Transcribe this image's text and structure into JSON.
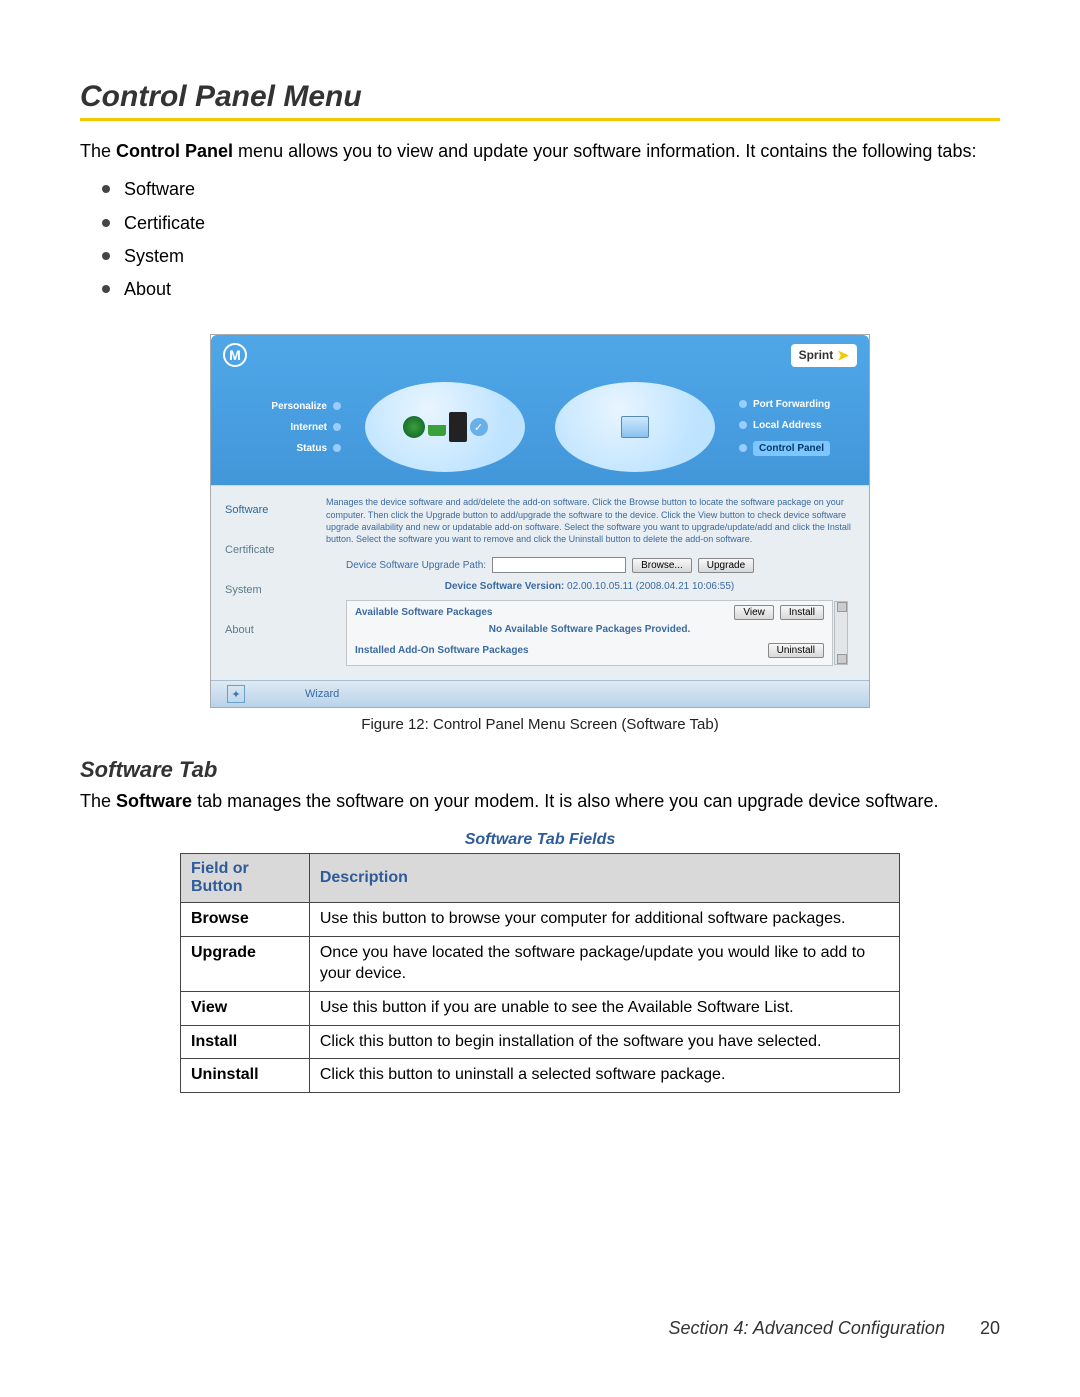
{
  "heading": "Control Panel Menu",
  "intro_pre": "The ",
  "intro_bold": "Control Panel",
  "intro_post": " menu allows you to view and update your software information. It contains the following tabs:",
  "bullets": [
    "Software",
    "Certificate",
    "System",
    "About"
  ],
  "screenshot": {
    "brand_logo_letter": "M",
    "sprint_label": "Sprint",
    "nav_left": [
      "Personalize",
      "Internet",
      "Status"
    ],
    "nav_right": [
      "Port Forwarding",
      "Local Address",
      "Control Panel"
    ],
    "side_tabs": [
      "Software",
      "Certificate",
      "System",
      "About"
    ],
    "help_text": "Manages the device software and add/delete the add-on software. Click the Browse button to locate the software package on your computer. Then click the Upgrade button to add/upgrade the software to the device. Click the View button to check device software upgrade availability and new or updatable add-on software. Select the software you want to upgrade/update/add and click the Install button. Select the software you want to remove and click the Uninstall button to delete the add-on software.",
    "upgrade_path_label": "Device Software Upgrade Path:",
    "browse_btn": "Browse...",
    "upgrade_btn": "Upgrade",
    "version_label": "Device Software Version:",
    "version_value": "02.00.10.05.11 (2008.04.21 10:06:55)",
    "available_title": "Available Software Packages",
    "view_btn": "View",
    "install_btn": "Install",
    "no_pkg_msg": "No Available Software Packages Provided.",
    "installed_title": "Installed Add-On Software Packages",
    "uninstall_btn": "Uninstall",
    "wizard_label": "Wizard"
  },
  "figure_caption": "Figure 12: Control Panel Menu Screen (Software Tab)",
  "subheading": "Software Tab",
  "sub_intro_pre": "The ",
  "sub_intro_bold": "Software",
  "sub_intro_post": " tab manages the software on your modem. It is also where you can upgrade device software.",
  "table_title": "Software Tab Fields",
  "table_headers": [
    "Field or Button",
    "Description"
  ],
  "table_rows": [
    {
      "field": "Browse",
      "desc": "Use this button to browse your computer for additional software packages."
    },
    {
      "field": "Upgrade",
      "desc": "Once you have located the software package/update you would like to add to your device."
    },
    {
      "field": "View",
      "desc": "Use this button if you are unable to see the Available Software List."
    },
    {
      "field": "Install",
      "desc": "Click this button to begin installation of the software you have selected."
    },
    {
      "field": "Uninstall",
      "desc": "Click this button to uninstall a selected software package."
    }
  ],
  "footer_section": "Section 4: Advanced Configuration",
  "footer_page": "20"
}
